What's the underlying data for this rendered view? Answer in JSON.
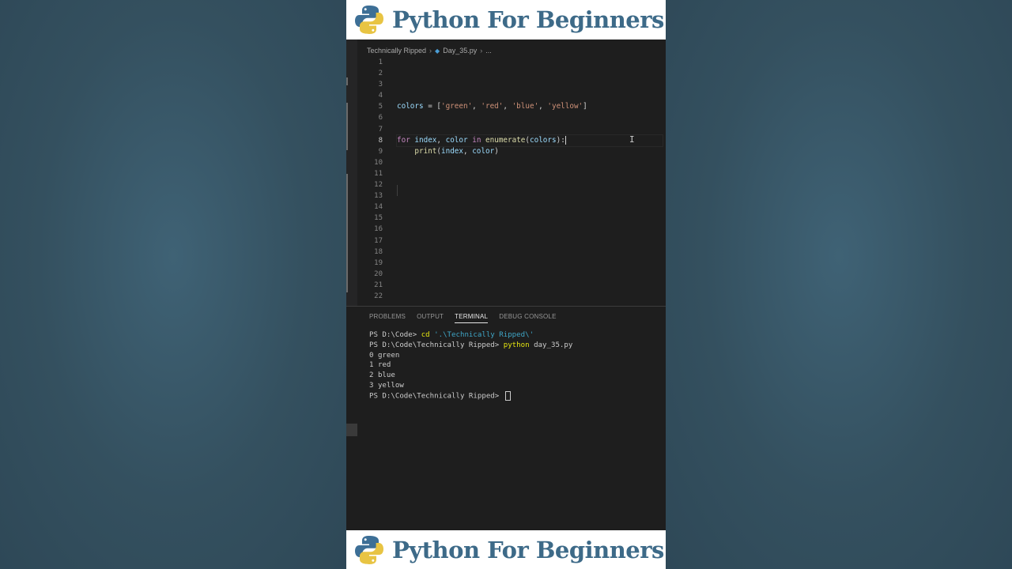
{
  "banner": {
    "title": "Python For Beginners",
    "logo_icon": "python-logo-icon",
    "title_color": "#3d6a88"
  },
  "breadcrumb": {
    "folder": "Technically Ripped",
    "file": "Day_35.py",
    "more": "..."
  },
  "editor": {
    "line_numbers": [
      "1",
      "2",
      "3",
      "4",
      "5",
      "6",
      "7",
      "8",
      "9",
      "10",
      "11",
      "12",
      "13",
      "14",
      "15",
      "16",
      "17",
      "18",
      "19",
      "20",
      "21",
      "22"
    ],
    "active_line": "8",
    "code": {
      "line5": {
        "var": "colors",
        "op": " = [",
        "s1": "'green'",
        "c1": ", ",
        "s2": "'red'",
        "c2": ", ",
        "s3": "'blue'",
        "c3": ", ",
        "s4": "'yellow'",
        "close": "]"
      },
      "line8": {
        "kw_for": "for",
        "v1": "index",
        "comma": ", ",
        "v2": "color",
        "kw_in": "in",
        "fn": "enumerate",
        "open": "(",
        "arg": "colors",
        "close": "):"
      },
      "line9": {
        "fn": "print",
        "open": "(",
        "a1": "index",
        "comma": ", ",
        "a2": "color",
        "close": ")"
      }
    }
  },
  "panel": {
    "tabs": [
      "PROBLEMS",
      "OUTPUT",
      "TERMINAL",
      "DEBUG CONSOLE"
    ],
    "active_tab": "TERMINAL"
  },
  "terminal": {
    "line1": {
      "prompt": "PS D:\\Code> ",
      "cmd": "cd",
      "arg": " '.\\Technically Ripped\\'"
    },
    "line2": {
      "prompt": "PS D:\\Code\\Technically Ripped> ",
      "cmd": "python",
      "arg": " day_35.py"
    },
    "output": [
      "0 green",
      "1 red",
      "2 blue",
      "3 yellow"
    ],
    "line_last": {
      "prompt": "PS D:\\Code\\Technically Ripped> "
    }
  }
}
